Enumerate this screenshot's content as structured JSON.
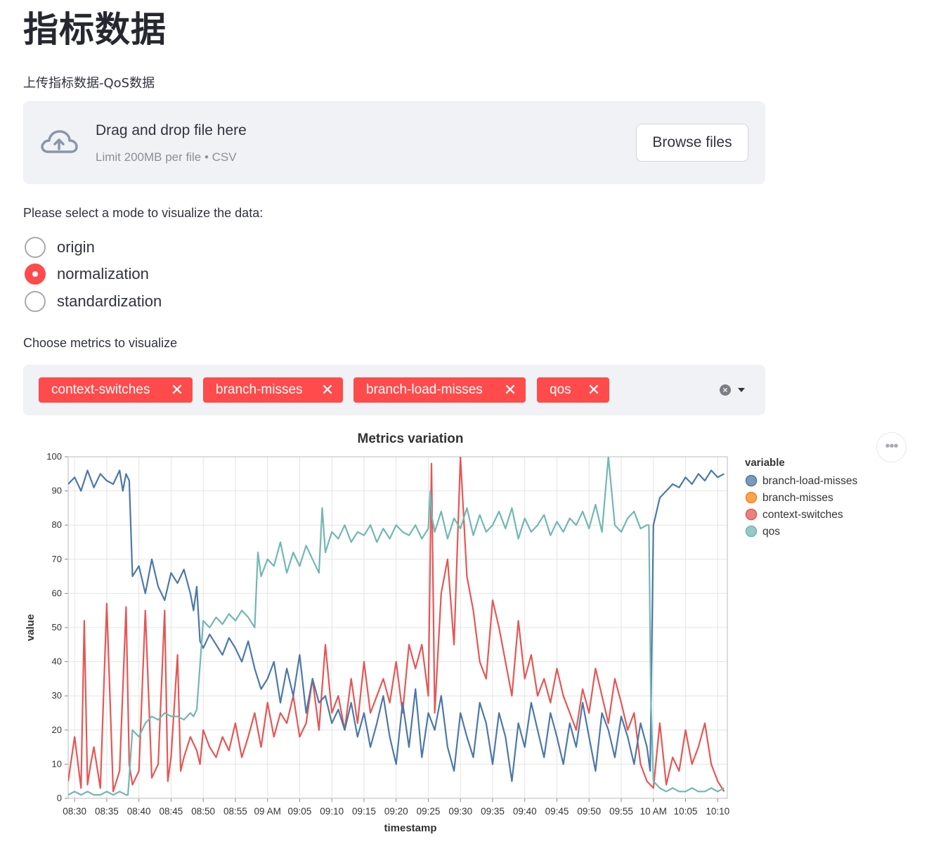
{
  "page": {
    "title": "指标数据",
    "upload_label": "上传指标数据-QoS数据"
  },
  "uploader": {
    "title": "Drag and drop file here",
    "subtitle": "Limit 200MB per file • CSV",
    "browse_label": "Browse files",
    "icon": "cloud-upload-icon"
  },
  "mode": {
    "label": "Please select a mode to visualize the data:",
    "options": [
      "origin",
      "normalization",
      "standardization"
    ],
    "selected": "normalization"
  },
  "metrics": {
    "label": "Choose metrics to visualize",
    "selected": [
      "context-switches",
      "branch-misses",
      "branch-load-misses",
      "qos"
    ]
  },
  "colors": {
    "accent": "#ff4b4b",
    "branch-load-misses": "#4c78a8",
    "branch-misses": "#f58518",
    "context-switches": "#e45756",
    "qos": "#72b7b2"
  },
  "chart_data": {
    "type": "line",
    "title": "Metrics variation",
    "xlabel": "timestamp",
    "ylabel": "value",
    "ylim": [
      0,
      100
    ],
    "y_ticks": [
      "0",
      "10",
      "20",
      "30",
      "40",
      "50",
      "60",
      "70",
      "80",
      "90",
      "100"
    ],
    "x_ticks": [
      "08:30",
      "08:35",
      "08:40",
      "08:45",
      "08:50",
      "08:55",
      "09 AM",
      "09:05",
      "09:10",
      "09:15",
      "09:20",
      "09:25",
      "09:30",
      "09:35",
      "09:40",
      "09:45",
      "09:50",
      "09:55",
      "10 AM",
      "10:05",
      "10:10"
    ],
    "x_range_minutes": [
      -1,
      101.5
    ],
    "legend": {
      "title": "variable",
      "position": "right",
      "entries": [
        "branch-load-misses",
        "branch-misses",
        "context-switches",
        "qos"
      ]
    },
    "grid": true,
    "series": [
      {
        "name": "context-switches",
        "x_minutes": [
          -1,
          0,
          1,
          1.5,
          2,
          2.5,
          3,
          4,
          5,
          6,
          6.5,
          7,
          8,
          8.5,
          9,
          10,
          11,
          12,
          13,
          14,
          14.5,
          15,
          16,
          16.5,
          17,
          18,
          19,
          19.5,
          20,
          21,
          22,
          23,
          24,
          25,
          26,
          27,
          28,
          29,
          30,
          31,
          32,
          33,
          34,
          35,
          36,
          37,
          38,
          39,
          40,
          41,
          42,
          43,
          44,
          45,
          46,
          47,
          48,
          49,
          50,
          51,
          52,
          53,
          54,
          55,
          55.5,
          56,
          57,
          58,
          59,
          60,
          61,
          62,
          63,
          64,
          65,
          66,
          67,
          68,
          69,
          70,
          71,
          72,
          73,
          74,
          75,
          76,
          77,
          78,
          79,
          80,
          81,
          82,
          83,
          84,
          85,
          86,
          87,
          88,
          89,
          90,
          91,
          92,
          93,
          94,
          95,
          96,
          97,
          98,
          99,
          100,
          101
        ],
        "values": [
          5,
          18,
          3,
          52,
          4,
          10,
          15,
          3,
          57,
          2,
          5,
          8,
          56,
          10,
          4,
          8,
          55,
          6,
          10,
          55,
          5,
          12,
          42,
          8,
          12,
          18,
          14,
          10,
          20,
          15,
          12,
          18,
          14,
          22,
          12,
          18,
          25,
          15,
          28,
          18,
          25,
          22,
          30,
          18,
          22,
          35,
          20,
          45,
          25,
          30,
          20,
          35,
          22,
          40,
          25,
          30,
          35,
          28,
          40,
          25,
          45,
          38,
          45,
          30,
          98,
          25,
          60,
          70,
          45,
          100,
          65,
          55,
          40,
          35,
          58,
          50,
          40,
          30,
          52,
          35,
          42,
          30,
          35,
          28,
          38,
          30,
          25,
          20,
          32,
          25,
          38,
          30,
          22,
          35,
          28,
          20,
          25,
          10,
          5,
          3,
          22,
          4,
          12,
          8,
          20,
          10,
          15,
          22,
          10,
          5,
          2
        ]
      },
      {
        "name": "branch-load-misses",
        "x_minutes": [
          -1,
          0,
          1,
          2,
          3,
          4,
          5,
          6,
          7,
          7.5,
          8,
          8.5,
          9,
          10,
          11,
          12,
          13,
          14,
          15,
          16,
          17,
          18,
          18.5,
          19,
          19.5,
          20,
          21,
          22,
          23,
          24,
          25,
          26,
          27,
          28,
          29,
          30,
          31,
          32,
          33,
          34,
          35,
          36,
          37,
          38,
          39,
          40,
          41,
          42,
          43,
          44,
          45,
          46,
          47,
          48,
          49,
          50,
          51,
          52,
          53,
          54,
          55,
          56,
          57,
          58,
          59,
          60,
          61,
          62,
          63,
          64,
          65,
          66,
          67,
          68,
          69,
          70,
          71,
          72,
          73,
          74,
          75,
          76,
          77,
          78,
          79,
          80,
          81,
          82,
          83,
          84,
          85,
          86,
          87,
          88,
          89,
          89.5,
          90,
          91,
          92,
          93,
          94,
          95,
          96,
          97,
          98,
          99,
          100,
          101
        ],
        "values": [
          92,
          94,
          90,
          96,
          91,
          95,
          93,
          92,
          96,
          90,
          95,
          93,
          65,
          68,
          60,
          70,
          62,
          58,
          66,
          63,
          67,
          60,
          55,
          62,
          46,
          44,
          48,
          45,
          42,
          47,
          44,
          40,
          46,
          38,
          32,
          35,
          40,
          28,
          38,
          30,
          42,
          25,
          35,
          28,
          30,
          22,
          26,
          20,
          28,
          18,
          25,
          15,
          22,
          30,
          18,
          10,
          28,
          15,
          32,
          12,
          25,
          20,
          30,
          15,
          8,
          25,
          18,
          12,
          28,
          22,
          10,
          25,
          18,
          5,
          22,
          15,
          28,
          20,
          12,
          25,
          18,
          10,
          22,
          15,
          28,
          18,
          8,
          25,
          20,
          12,
          24,
          18,
          10,
          22,
          15,
          8,
          80,
          88,
          90,
          92,
          91,
          94,
          92,
          95,
          93,
          96,
          94,
          95
        ]
      },
      {
        "name": "qos",
        "x_minutes": [
          -1,
          0,
          1,
          2,
          3,
          4,
          5,
          6,
          7,
          8,
          8.3,
          9,
          10,
          11,
          12,
          13,
          14,
          15,
          16,
          17,
          18,
          18.5,
          19,
          20,
          21,
          22,
          23,
          24,
          25,
          26,
          27,
          28,
          28.5,
          29,
          30,
          31,
          32,
          33,
          34,
          35,
          36,
          37,
          38,
          38.5,
          39,
          40,
          41,
          42,
          43,
          44,
          45,
          46,
          47,
          48,
          49,
          50,
          51,
          52,
          53,
          54,
          55,
          55.3,
          55.6,
          56,
          57,
          58,
          59,
          60,
          61,
          62,
          63,
          64,
          65,
          66,
          67,
          68,
          69,
          70,
          71,
          72,
          73,
          74,
          75,
          76,
          77,
          78,
          79,
          80,
          81,
          82,
          83,
          84,
          85,
          86,
          87,
          88,
          89,
          89.3,
          89.6,
          90,
          91,
          92,
          93,
          94,
          95,
          96,
          97,
          98,
          99,
          100,
          101
        ],
        "values": [
          1,
          2,
          1,
          2,
          1,
          1,
          2,
          1,
          2,
          1,
          1,
          20,
          18,
          22,
          24,
          23,
          25,
          24,
          24,
          23,
          25,
          24,
          26,
          52,
          50,
          53,
          51,
          54,
          52,
          55,
          53,
          50,
          72,
          65,
          70,
          68,
          75,
          66,
          72,
          68,
          74,
          70,
          66,
          85,
          72,
          78,
          76,
          80,
          75,
          78,
          77,
          80,
          75,
          79,
          76,
          80,
          78,
          77,
          80,
          76,
          79,
          90,
          82,
          78,
          84,
          76,
          82,
          79,
          85,
          77,
          83,
          78,
          80,
          84,
          79,
          85,
          76,
          82,
          78,
          80,
          83,
          77,
          81,
          78,
          82,
          80,
          84,
          79,
          86,
          78,
          100,
          80,
          78,
          82,
          84,
          79,
          80,
          80,
          30,
          5,
          3,
          2,
          3,
          2,
          2,
          3,
          2,
          2,
          3,
          2,
          3
        ]
      }
    ]
  }
}
